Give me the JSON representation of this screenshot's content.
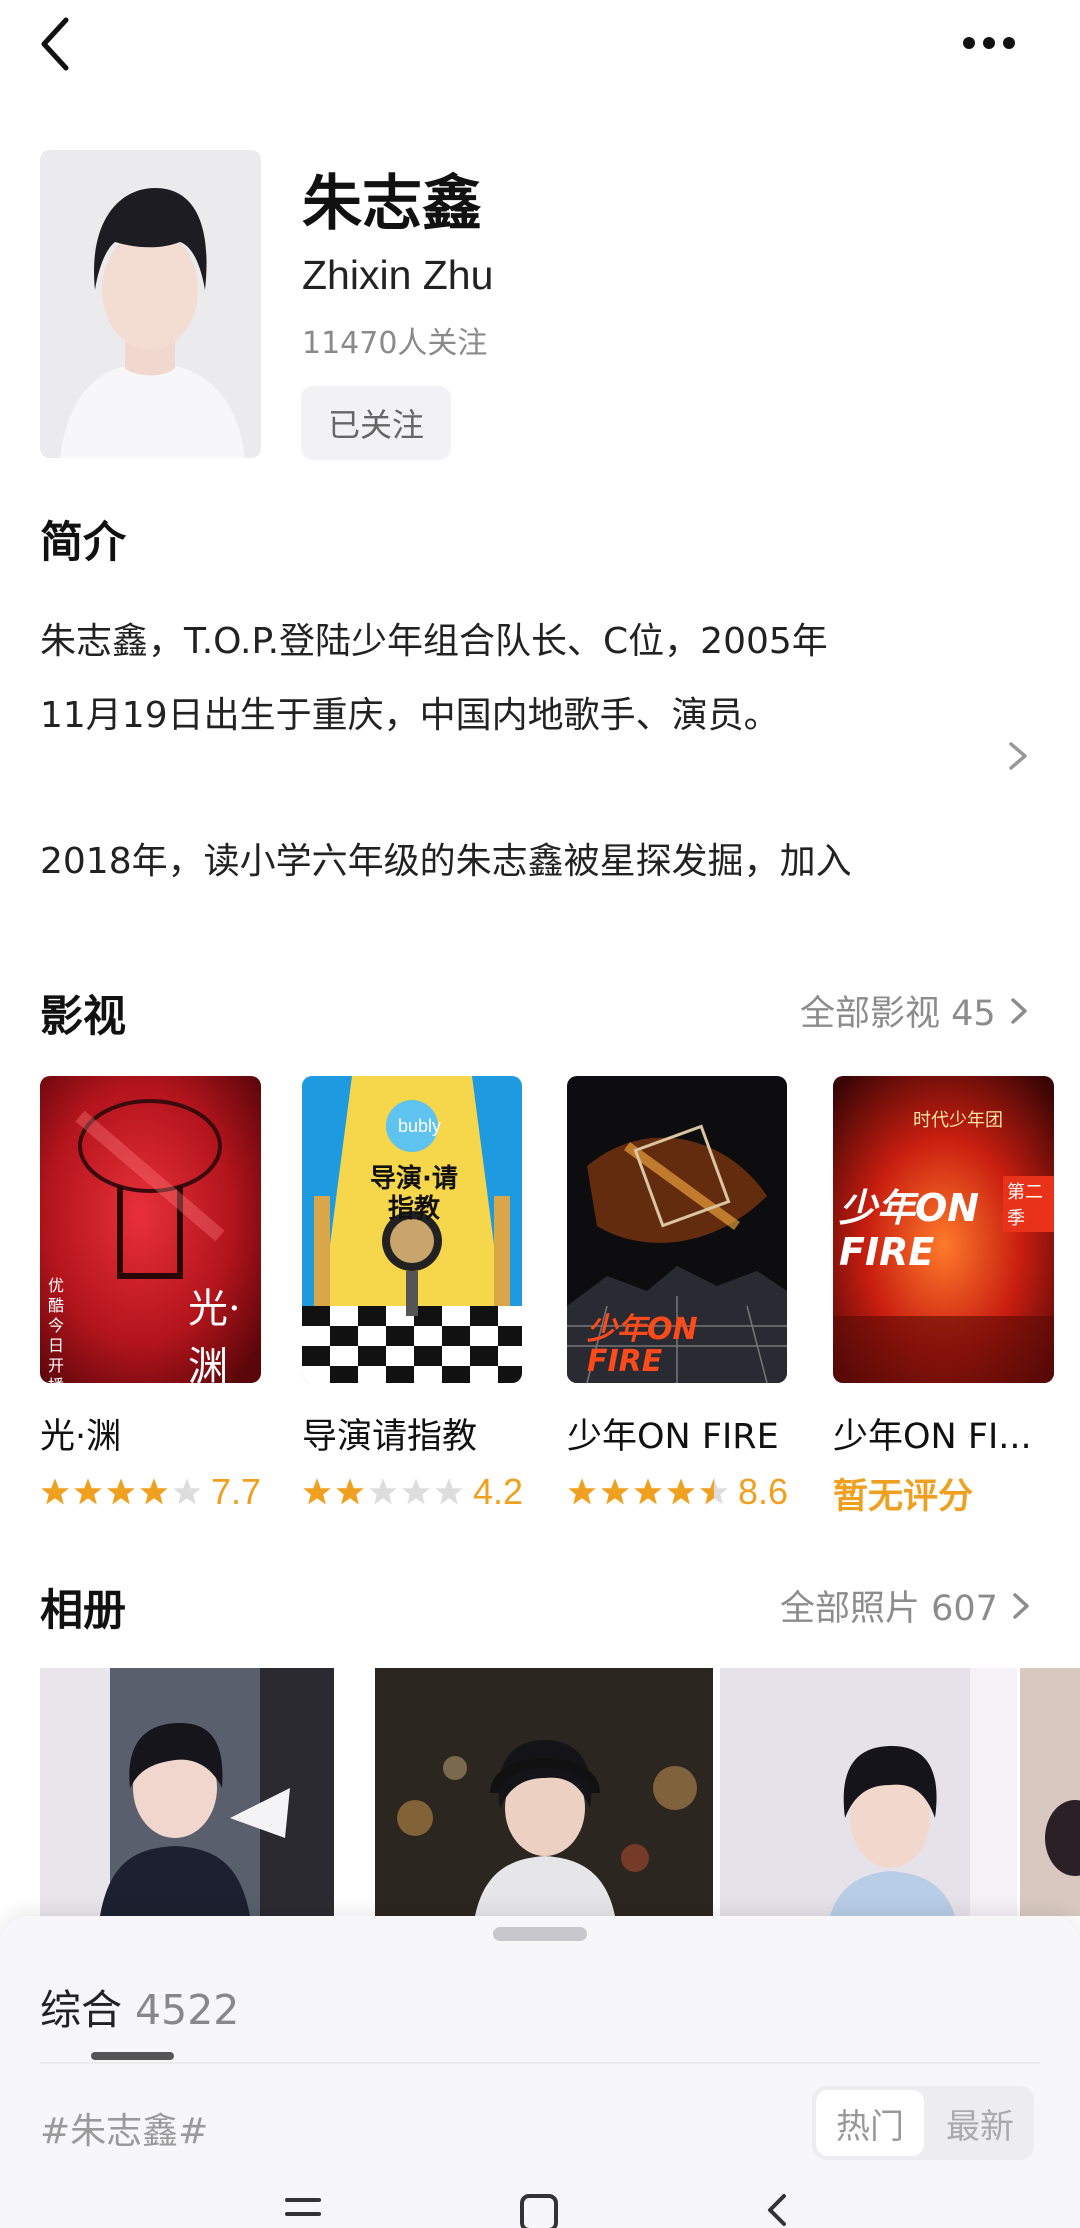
{
  "header": {
    "name": "朱志鑫",
    "en_name": "Zhixin Zhu",
    "followers": "11470人关注",
    "follow_label": "已关注"
  },
  "intro": {
    "title": "简介",
    "lines": [
      "朱志鑫，T.O.P.登陆少年组合队长、C位，2005年",
      "11月19日出生于重庆，中国内地歌手、演员。",
      "2018年，读小学六年级的朱志鑫被星探发掘，加入"
    ]
  },
  "movies": {
    "title": "影视",
    "more_label": "全部影视 45",
    "items": [
      {
        "title": "光·渊",
        "rating": 3.85,
        "score": "7.7",
        "poster_text": "光·渊",
        "side_text": "优酷今日开播"
      },
      {
        "title": "导演请指教",
        "rating": 2.1,
        "score": "4.2",
        "poster_text": "导演·请指教",
        "badge": "bubly"
      },
      {
        "title": "少年ON FIRE",
        "rating": 4.3,
        "score": "8.6",
        "poster_text": "少年ON FIRE"
      },
      {
        "title": "少年ON FI...",
        "score_text": "暂无评分",
        "poster_text": "少年ON FIRE",
        "badge": "时代少年团",
        "corner": "第二季"
      }
    ]
  },
  "album": {
    "title": "相册",
    "more_label": "全部照片 607"
  },
  "sheet": {
    "tab_label": "综合",
    "tab_count": "4522",
    "tag": "#朱志鑫#",
    "sort_hot": "热门",
    "sort_new": "最新"
  },
  "colors": {
    "accent": "#f0a020",
    "muted": "#8c8c8c"
  }
}
